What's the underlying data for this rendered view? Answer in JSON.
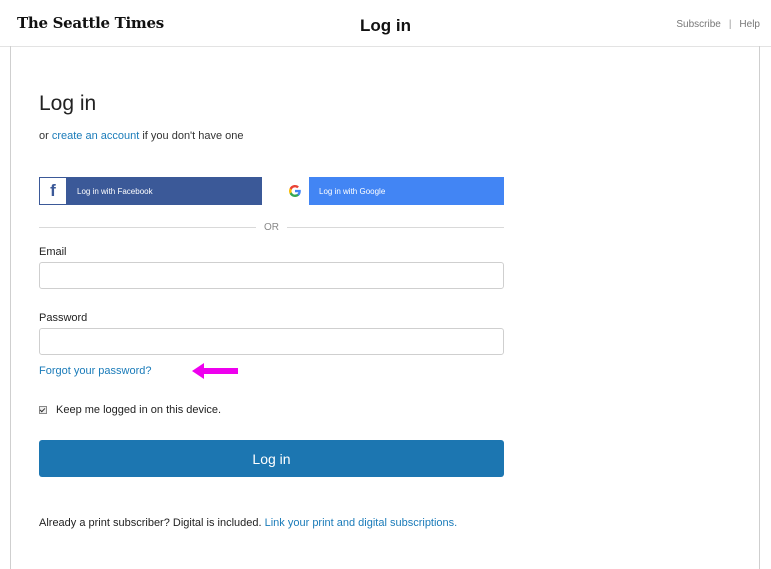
{
  "header": {
    "logo": "The Seattle Times",
    "title": "Log in",
    "subscribe": "Subscribe",
    "separator": "|",
    "help": "Help"
  },
  "main": {
    "title": "Log in",
    "subtitle_prefix": "or",
    "create_account_link": "create an account",
    "subtitle_suffix": "if you don't have one",
    "facebook_button": "Log in with Facebook",
    "google_button": "Log in with Google",
    "divider": "OR",
    "email_label": "Email",
    "email_value": "",
    "password_label": "Password",
    "password_value": "",
    "forgot_link": "Forgot your password?",
    "remember_label": "Keep me logged in on this device.",
    "remember_checked": true,
    "login_button": "Log in",
    "footer_text": "Already a print subscriber? Digital is included.",
    "footer_link": "Link your print and digital subscriptions."
  },
  "colors": {
    "facebook": "#3b5998",
    "google": "#4285f4",
    "primary_button": "#1c76b1",
    "link": "#1a7bb9",
    "annotation_arrow": "#ee00ee"
  },
  "icons": [
    "facebook-icon",
    "google-icon",
    "checkbox-checked-icon",
    "annotation-arrow-icon"
  ]
}
